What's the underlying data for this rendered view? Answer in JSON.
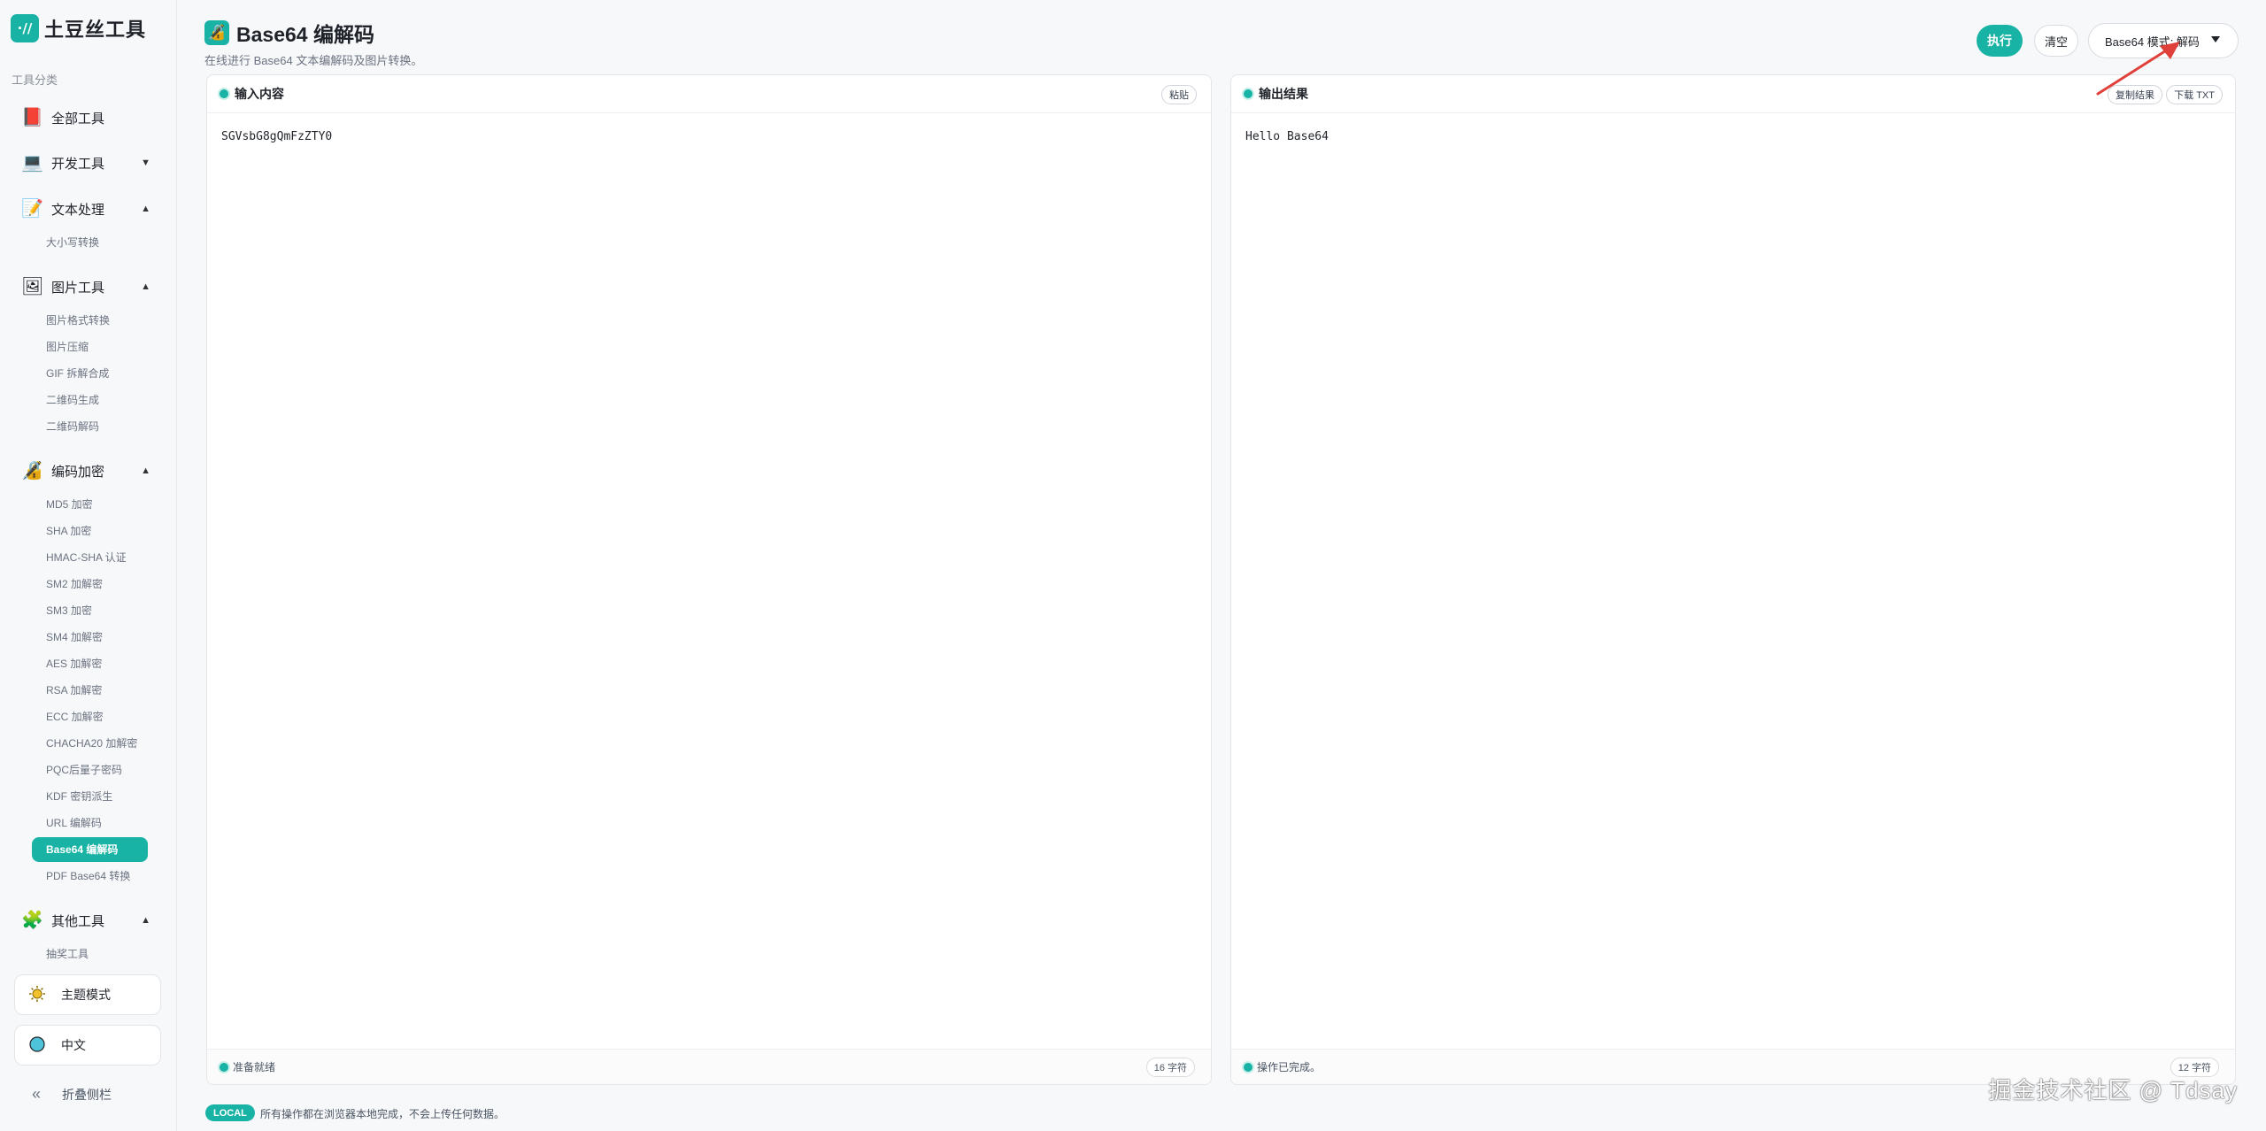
{
  "brand": {
    "logo": "·//",
    "name": "土豆丝工具"
  },
  "sidebar": {
    "section_label": "工具分类",
    "groups": [
      {
        "label": "全部工具",
        "icon": "book-icon",
        "glyph": "📕",
        "arrow": ""
      },
      {
        "label": "开发工具",
        "icon": "laptop-icon",
        "glyph": "💻",
        "arrow": "▼"
      },
      {
        "label": "文本处理",
        "icon": "memo-icon",
        "glyph": "📝",
        "arrow": "▲"
      },
      {
        "label": "图片工具",
        "icon": "picture-icon",
        "glyph": "🖼",
        "arrow": "▲"
      },
      {
        "label": "编码加密",
        "icon": "lock-icon",
        "glyph": "🔏",
        "arrow": "▲"
      },
      {
        "label": "其他工具",
        "icon": "puzzle-icon",
        "glyph": "🧩",
        "arrow": "▲"
      }
    ],
    "text_items": [
      "大小写转换"
    ],
    "image_items": [
      "图片格式转换",
      "图片压缩",
      "GIF 拆解合成",
      "二维码生成",
      "二维码解码"
    ],
    "crypto_items": [
      "MD5 加密",
      "SHA 加密",
      "HMAC-SHA 认证",
      "SM2 加解密",
      "SM3 加密",
      "SM4 加解密",
      "AES 加解密",
      "RSA 加解密",
      "ECC 加解密",
      "CHACHA20 加解密",
      "PQC后量子密码",
      "KDF 密钥派生",
      "URL 编解码",
      "Base64 编解码",
      "PDF Base64 转换"
    ],
    "other_items": [
      "抽奖工具"
    ],
    "theme_label": "主题模式",
    "lang_label": "中文",
    "collapse_label": "折叠侧栏"
  },
  "header": {
    "title": "Base64 编解码",
    "subtitle": "在线进行 Base64 文本编解码及图片转换。",
    "exec_label": "执行",
    "clear_label": "清空",
    "mode_label": "Base64 模式:  解码"
  },
  "input_panel": {
    "title": "输入内容",
    "paste_label": "粘贴",
    "content": "SGVsbG8gQmFzZTY0",
    "status": "准备就绪",
    "count": "16 字符"
  },
  "output_panel": {
    "title": "输出结果",
    "copy_label": "复制结果",
    "download_label": "下载 TXT",
    "content": "Hello Base64",
    "status": "操作已完成。",
    "count": "12 字符"
  },
  "footer": {
    "badge": "LOCAL",
    "note": "所有操作都在浏览器本地完成，不会上传任何数据。"
  },
  "watermark": "掘金技术社区 @ Tdsay",
  "colors": {
    "accent": "#19b3a5",
    "annotation_arrow": "#e0403a"
  }
}
